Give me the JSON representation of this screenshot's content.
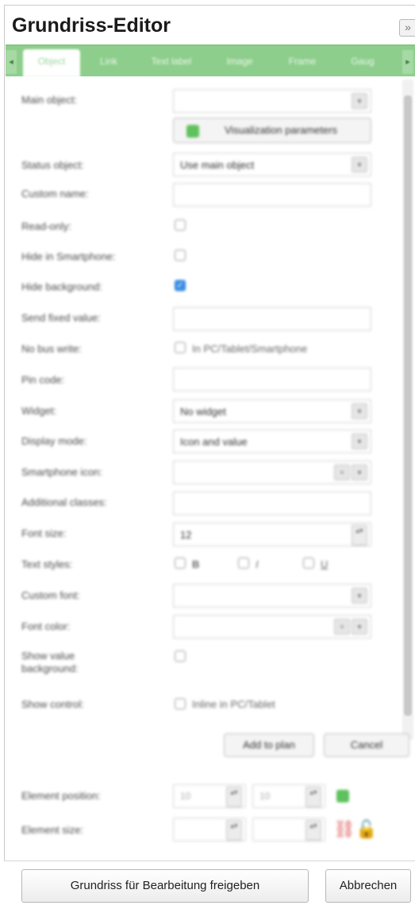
{
  "dialog": {
    "title": "Grundriss-Editor",
    "collapse_glyph": "»"
  },
  "tabs": [
    {
      "label": "Object"
    },
    {
      "label": "Link"
    },
    {
      "label": "Text label"
    },
    {
      "label": "Image"
    },
    {
      "label": "Frame"
    },
    {
      "label": "Gaug"
    }
  ],
  "tab_nav": {
    "prev": "◂",
    "next": "▸"
  },
  "form": {
    "main_object": {
      "label": "Main object:",
      "value": ""
    },
    "visualization_button": "Visualization parameters",
    "status_object": {
      "label": "Status object:",
      "value": "Use main object"
    },
    "custom_name": {
      "label": "Custom name:",
      "value": ""
    },
    "read_only": {
      "label": "Read-only:",
      "checked": false
    },
    "hide_in_smartphone": {
      "label": "Hide in Smartphone:",
      "checked": false
    },
    "hide_background": {
      "label": "Hide background:",
      "checked": true
    },
    "send_fixed_value": {
      "label": "Send fixed value:",
      "value": ""
    },
    "no_bus_write": {
      "label": "No bus write:",
      "option": "In PC/Tablet/Smartphone",
      "checked": false
    },
    "pin_code": {
      "label": "Pin code:",
      "value": ""
    },
    "widget": {
      "label": "Widget:",
      "value": "No widget"
    },
    "display_mode": {
      "label": "Display mode:",
      "value": "Icon and value"
    },
    "smartphone_icon": {
      "label": "Smartphone icon:",
      "value": ""
    },
    "additional_classes": {
      "label": "Additional classes:",
      "value": ""
    },
    "font_size": {
      "label": "Font size:",
      "value": "12"
    },
    "text_styles": {
      "label": "Text styles:",
      "bold": "B",
      "italic": "I",
      "underline": "U"
    },
    "custom_font": {
      "label": "Custom font:",
      "value": ""
    },
    "font_color": {
      "label": "Font color:",
      "value": ""
    },
    "show_value_background": {
      "label": "Show value background:",
      "checked": false
    },
    "show_control": {
      "label": "Show control:",
      "option": "Inline in PC/Tablet",
      "checked": false
    },
    "add_to_plan": "Add to plan",
    "cancel": "Cancel",
    "element_position": {
      "label": "Element position:",
      "x": "10",
      "y": "10"
    },
    "element_size": {
      "label": "Element size:",
      "w": "",
      "h": ""
    }
  },
  "footer": {
    "release_button": "Grundriss für Bearbeitung freigeben",
    "cancel_button": "Abbrechen"
  },
  "icons": {
    "dropdown": "▾",
    "spin": "▴▾",
    "check": "✓",
    "unlink": "⛓",
    "lock": "🔓"
  },
  "colors": {
    "tab_bar": "#8ece8c",
    "checkbox_checked": "#3a8ee6",
    "accent_green": "#5fc15d"
  }
}
